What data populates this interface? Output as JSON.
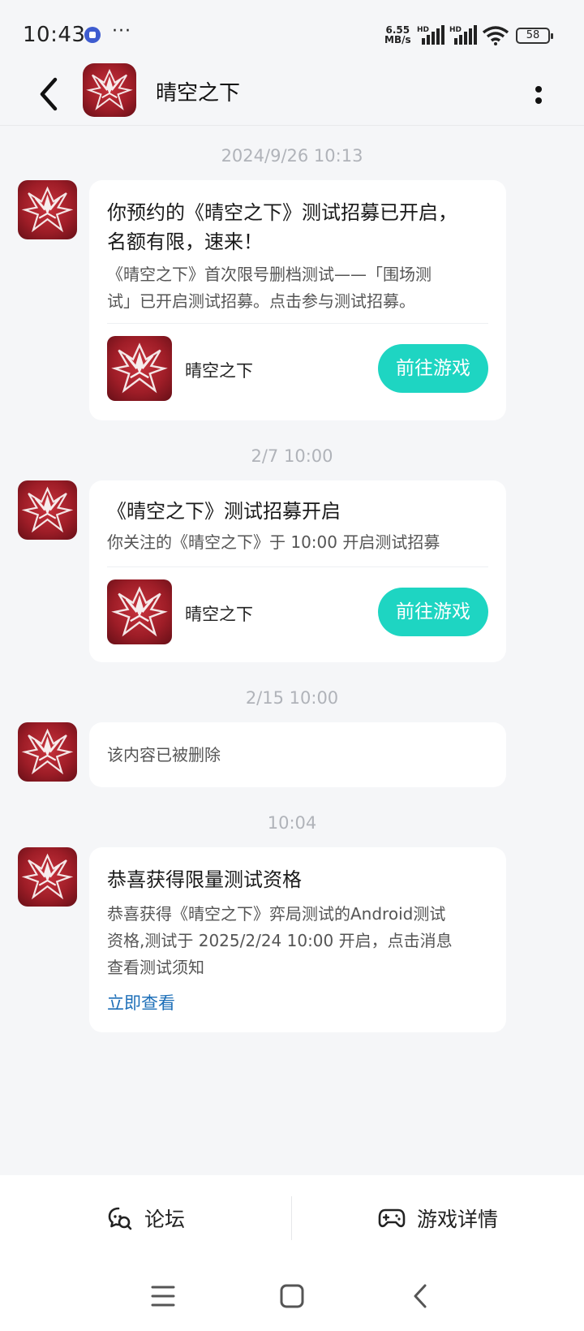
{
  "status_bar": {
    "time": "10:43",
    "more": "···",
    "net_speed_value": "6.55",
    "net_speed_unit": "MB/s",
    "signal_label": "HD",
    "battery": "58"
  },
  "header": {
    "title": "晴空之下",
    "icon_glyph": "晴空"
  },
  "messages": [
    {
      "timestamp": "2024/9/26  10:13",
      "title_line1": "你预约的《晴空之下》测试招募已开启，",
      "title_line2": "名额有限，速来！",
      "desc_line1": "《晴空之下》首次限号删档测试——「围场测",
      "desc_line2": "试」已开启测试招募。点击参与测试招募。",
      "game_name": "晴空之下",
      "button": "前往游戏"
    },
    {
      "timestamp": "2/7  10:00",
      "title": "《晴空之下》测试招募开启",
      "desc": "你关注的《晴空之下》于 10:00 开启测试招募",
      "game_name": "晴空之下",
      "button": "前往游戏"
    },
    {
      "timestamp": "2/15  10:00",
      "desc": "该内容已被删除"
    },
    {
      "timestamp": "10:04",
      "title": "恭喜获得限量测试资格",
      "desc_line1": "恭喜获得《晴空之下》弈局测试的Android测试",
      "desc_line2": "资格,测试于 2025/2/24 10:00 开启，点击消息",
      "desc_line3": "查看测试须知",
      "link": "立即查看"
    }
  ],
  "bottom_bar": {
    "forum": "论坛",
    "game_details": "游戏详情"
  },
  "colors": {
    "accent_button": "#1ed5c2",
    "link": "#1d6fb8",
    "background": "#f5f6f8",
    "icon_red": "#a8212b"
  },
  "icons": [
    "back-arrow-icon",
    "more-vertical-icon",
    "forum-chat-icon",
    "gamepad-icon",
    "menu-icon",
    "home-square-icon",
    "back-chevron-icon",
    "wifi-icon",
    "signal-icon",
    "battery-icon"
  ]
}
